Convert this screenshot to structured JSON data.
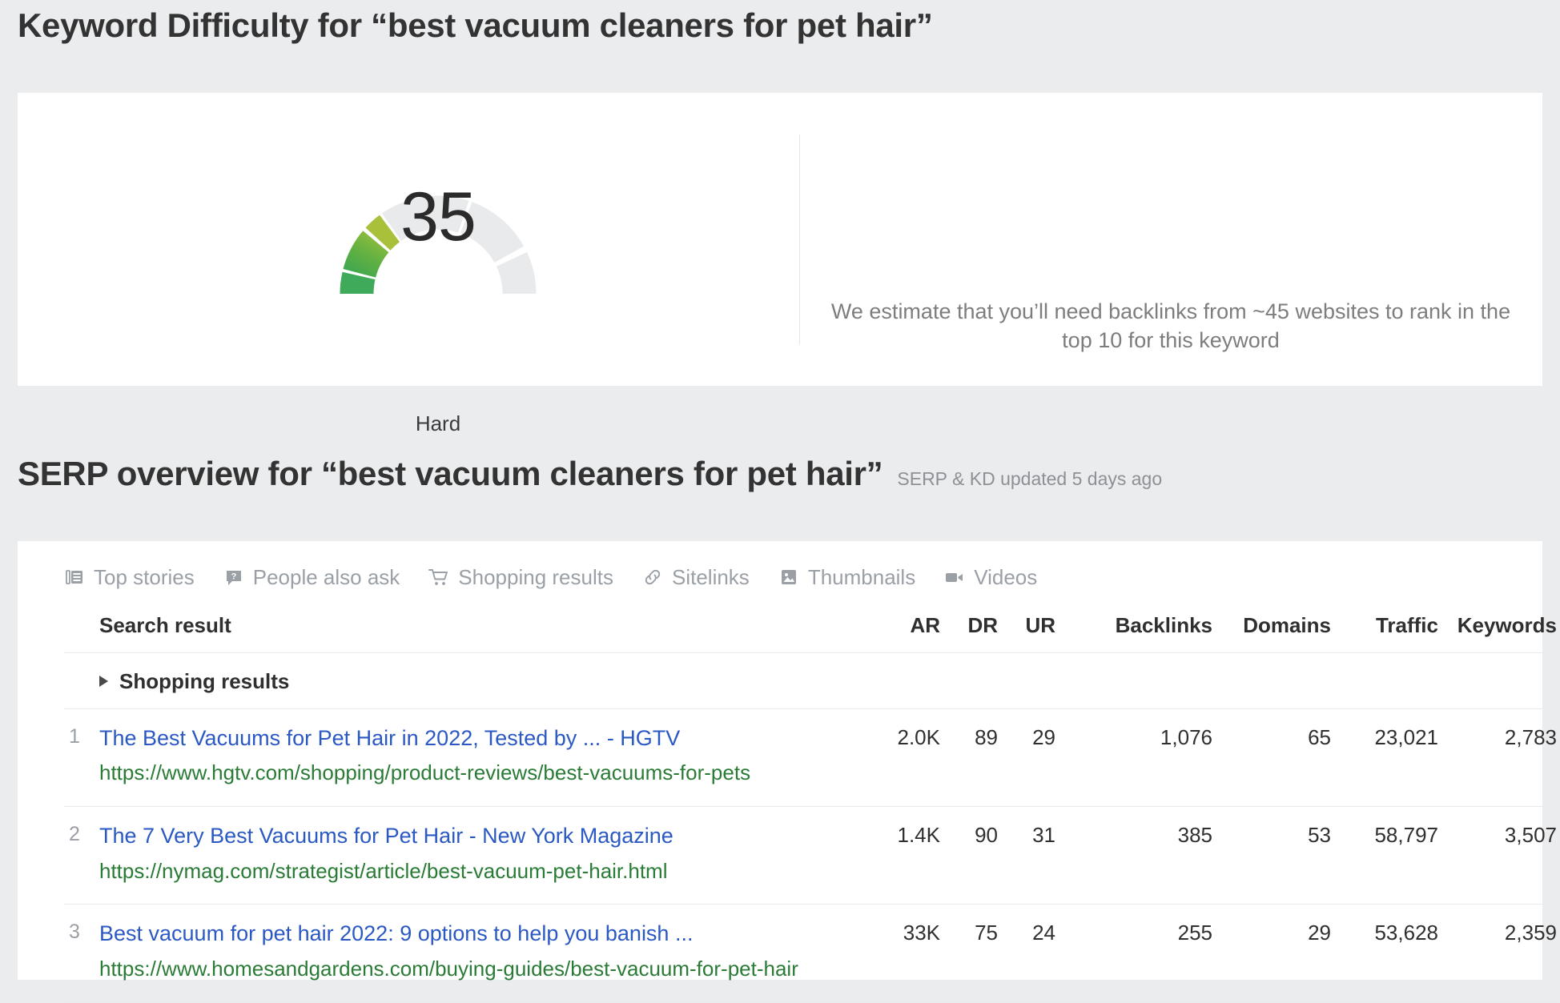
{
  "kd": {
    "heading": "Keyword Difficulty for “best vacuum cleaners for pet hair”",
    "score": "35",
    "label": "Hard",
    "note": "We estimate that you’ll need backlinks from ~45 websites to rank in the top 10 for this keyword",
    "colors": {
      "track": "#e9eaec",
      "green_dark": "#3faa5a",
      "green_mid": "#6cb33f",
      "green_light": "#a8c03a",
      "text_dark": "#2b2b2b"
    }
  },
  "serp": {
    "heading": "SERP overview for “best vacuum cleaners for pet hair”",
    "updated": "SERP & KD updated 5 days ago",
    "features": [
      {
        "icon": "top-stories-icon",
        "label": "Top stories"
      },
      {
        "icon": "people-also-ask-icon",
        "label": "People also ask"
      },
      {
        "icon": "shopping-cart-icon",
        "label": "Shopping results"
      },
      {
        "icon": "sitelinks-icon",
        "label": "Sitelinks"
      },
      {
        "icon": "thumbnails-icon",
        "label": "Thumbnails"
      },
      {
        "icon": "videos-icon",
        "label": "Videos"
      }
    ],
    "columns": {
      "search_result": "Search result",
      "ar": "AR",
      "dr": "DR",
      "ur": "UR",
      "backlinks": "Backlinks",
      "domains": "Domains",
      "traffic": "Traffic",
      "keywords": "Keywords"
    },
    "shopping_row": {
      "label": "Shopping results",
      "expanded": false
    },
    "rows": [
      {
        "rank": "1",
        "title": "The Best Vacuums for Pet Hair in 2022, Tested by ... - HGTV",
        "url": "https://www.hgtv.com/shopping/product-reviews/best-vacuums-for-pets",
        "ar": "2.0K",
        "dr": "89",
        "ur": "29",
        "backlinks": "1,076",
        "domains": "65",
        "traffic": "23,021",
        "keywords": "2,783"
      },
      {
        "rank": "2",
        "title": "The 7 Very Best Vacuums for Pet Hair - New York Magazine",
        "url": "https://nymag.com/strategist/article/best-vacuum-pet-hair.html",
        "ar": "1.4K",
        "dr": "90",
        "ur": "31",
        "backlinks": "385",
        "domains": "53",
        "traffic": "58,797",
        "keywords": "3,507"
      },
      {
        "rank": "3",
        "title": "Best vacuum for pet hair 2022: 9 options to help you banish ...",
        "url": "https://www.homesandgardens.com/buying-guides/best-vacuum-for-pet-hair",
        "ar": "33K",
        "dr": "75",
        "ur": "24",
        "backlinks": "255",
        "domains": "29",
        "traffic": "53,628",
        "keywords": "2,359"
      }
    ]
  },
  "chart_data": {
    "type": "pie",
    "title": "Keyword Difficulty gauge",
    "value": 35,
    "max": 100,
    "value_label": "35",
    "difficulty_label": "Hard",
    "segments": [
      {
        "name": "filled-dark-green",
        "start_deg": 0,
        "end_deg": 62,
        "color": "#3faa5a"
      },
      {
        "name": "filled-mid-green",
        "start_deg": 66,
        "end_deg": 108,
        "color": "#6cb33f"
      },
      {
        "name": "filled-light-green",
        "start_deg": 112,
        "end_deg": 126,
        "color": "#a8c03a"
      },
      {
        "name": "empty-track-1",
        "start_deg": 130,
        "end_deg": 236,
        "color": "#e9eaec"
      },
      {
        "name": "empty-track-2",
        "start_deg": 240,
        "end_deg": 270,
        "color": "#e9eaec"
      }
    ]
  }
}
